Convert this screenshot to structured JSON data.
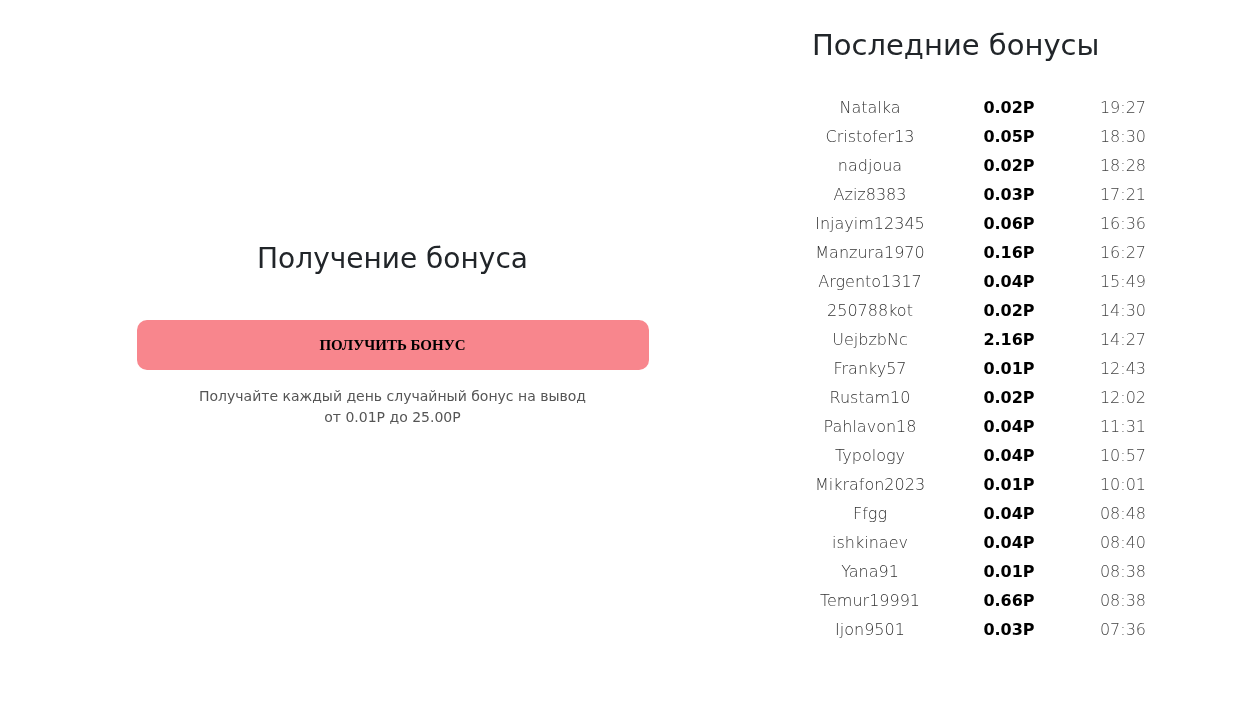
{
  "bonus": {
    "title": "Получение бонуса",
    "button": "ПОЛУЧИТЬ БОНУС",
    "description_lines": [
      "Получайте каждый день случайный бонус на вывод",
      "от 0.01P до 25.00P"
    ]
  },
  "recent": {
    "title": "Последние бонусы",
    "rows": [
      {
        "user": "Natalka",
        "amount": "0.02P",
        "time": "19:27"
      },
      {
        "user": "Cristofer13",
        "amount": "0.05P",
        "time": "18:30"
      },
      {
        "user": "nadjoua",
        "amount": "0.02P",
        "time": "18:28"
      },
      {
        "user": "Aziz8383",
        "amount": "0.03P",
        "time": "17:21"
      },
      {
        "user": "Injayim12345",
        "amount": "0.06P",
        "time": "16:36"
      },
      {
        "user": "Manzura1970",
        "amount": "0.16P",
        "time": "16:27"
      },
      {
        "user": "Argento1317",
        "amount": "0.04P",
        "time": "15:49"
      },
      {
        "user": "250788kot",
        "amount": "0.02P",
        "time": "14:30"
      },
      {
        "user": "UejbzbNc",
        "amount": "2.16P",
        "time": "14:27"
      },
      {
        "user": "Franky57",
        "amount": "0.01P",
        "time": "12:43"
      },
      {
        "user": "Rustam10",
        "amount": "0.02P",
        "time": "12:02"
      },
      {
        "user": "Pahlavon18",
        "amount": "0.04P",
        "time": "11:31"
      },
      {
        "user": "Typology",
        "amount": "0.04P",
        "time": "10:57"
      },
      {
        "user": "Mikrafon2023",
        "amount": "0.01P",
        "time": "10:01"
      },
      {
        "user": "Ffgg",
        "amount": "0.04P",
        "time": "08:48"
      },
      {
        "user": "ishkinaev",
        "amount": "0.04P",
        "time": "08:40"
      },
      {
        "user": "Yana91",
        "amount": "0.01P",
        "time": "08:38"
      },
      {
        "user": "Temur19991",
        "amount": "0.66P",
        "time": "08:38"
      },
      {
        "user": "Ijon9501",
        "amount": "0.03P",
        "time": "07:36"
      }
    ]
  }
}
